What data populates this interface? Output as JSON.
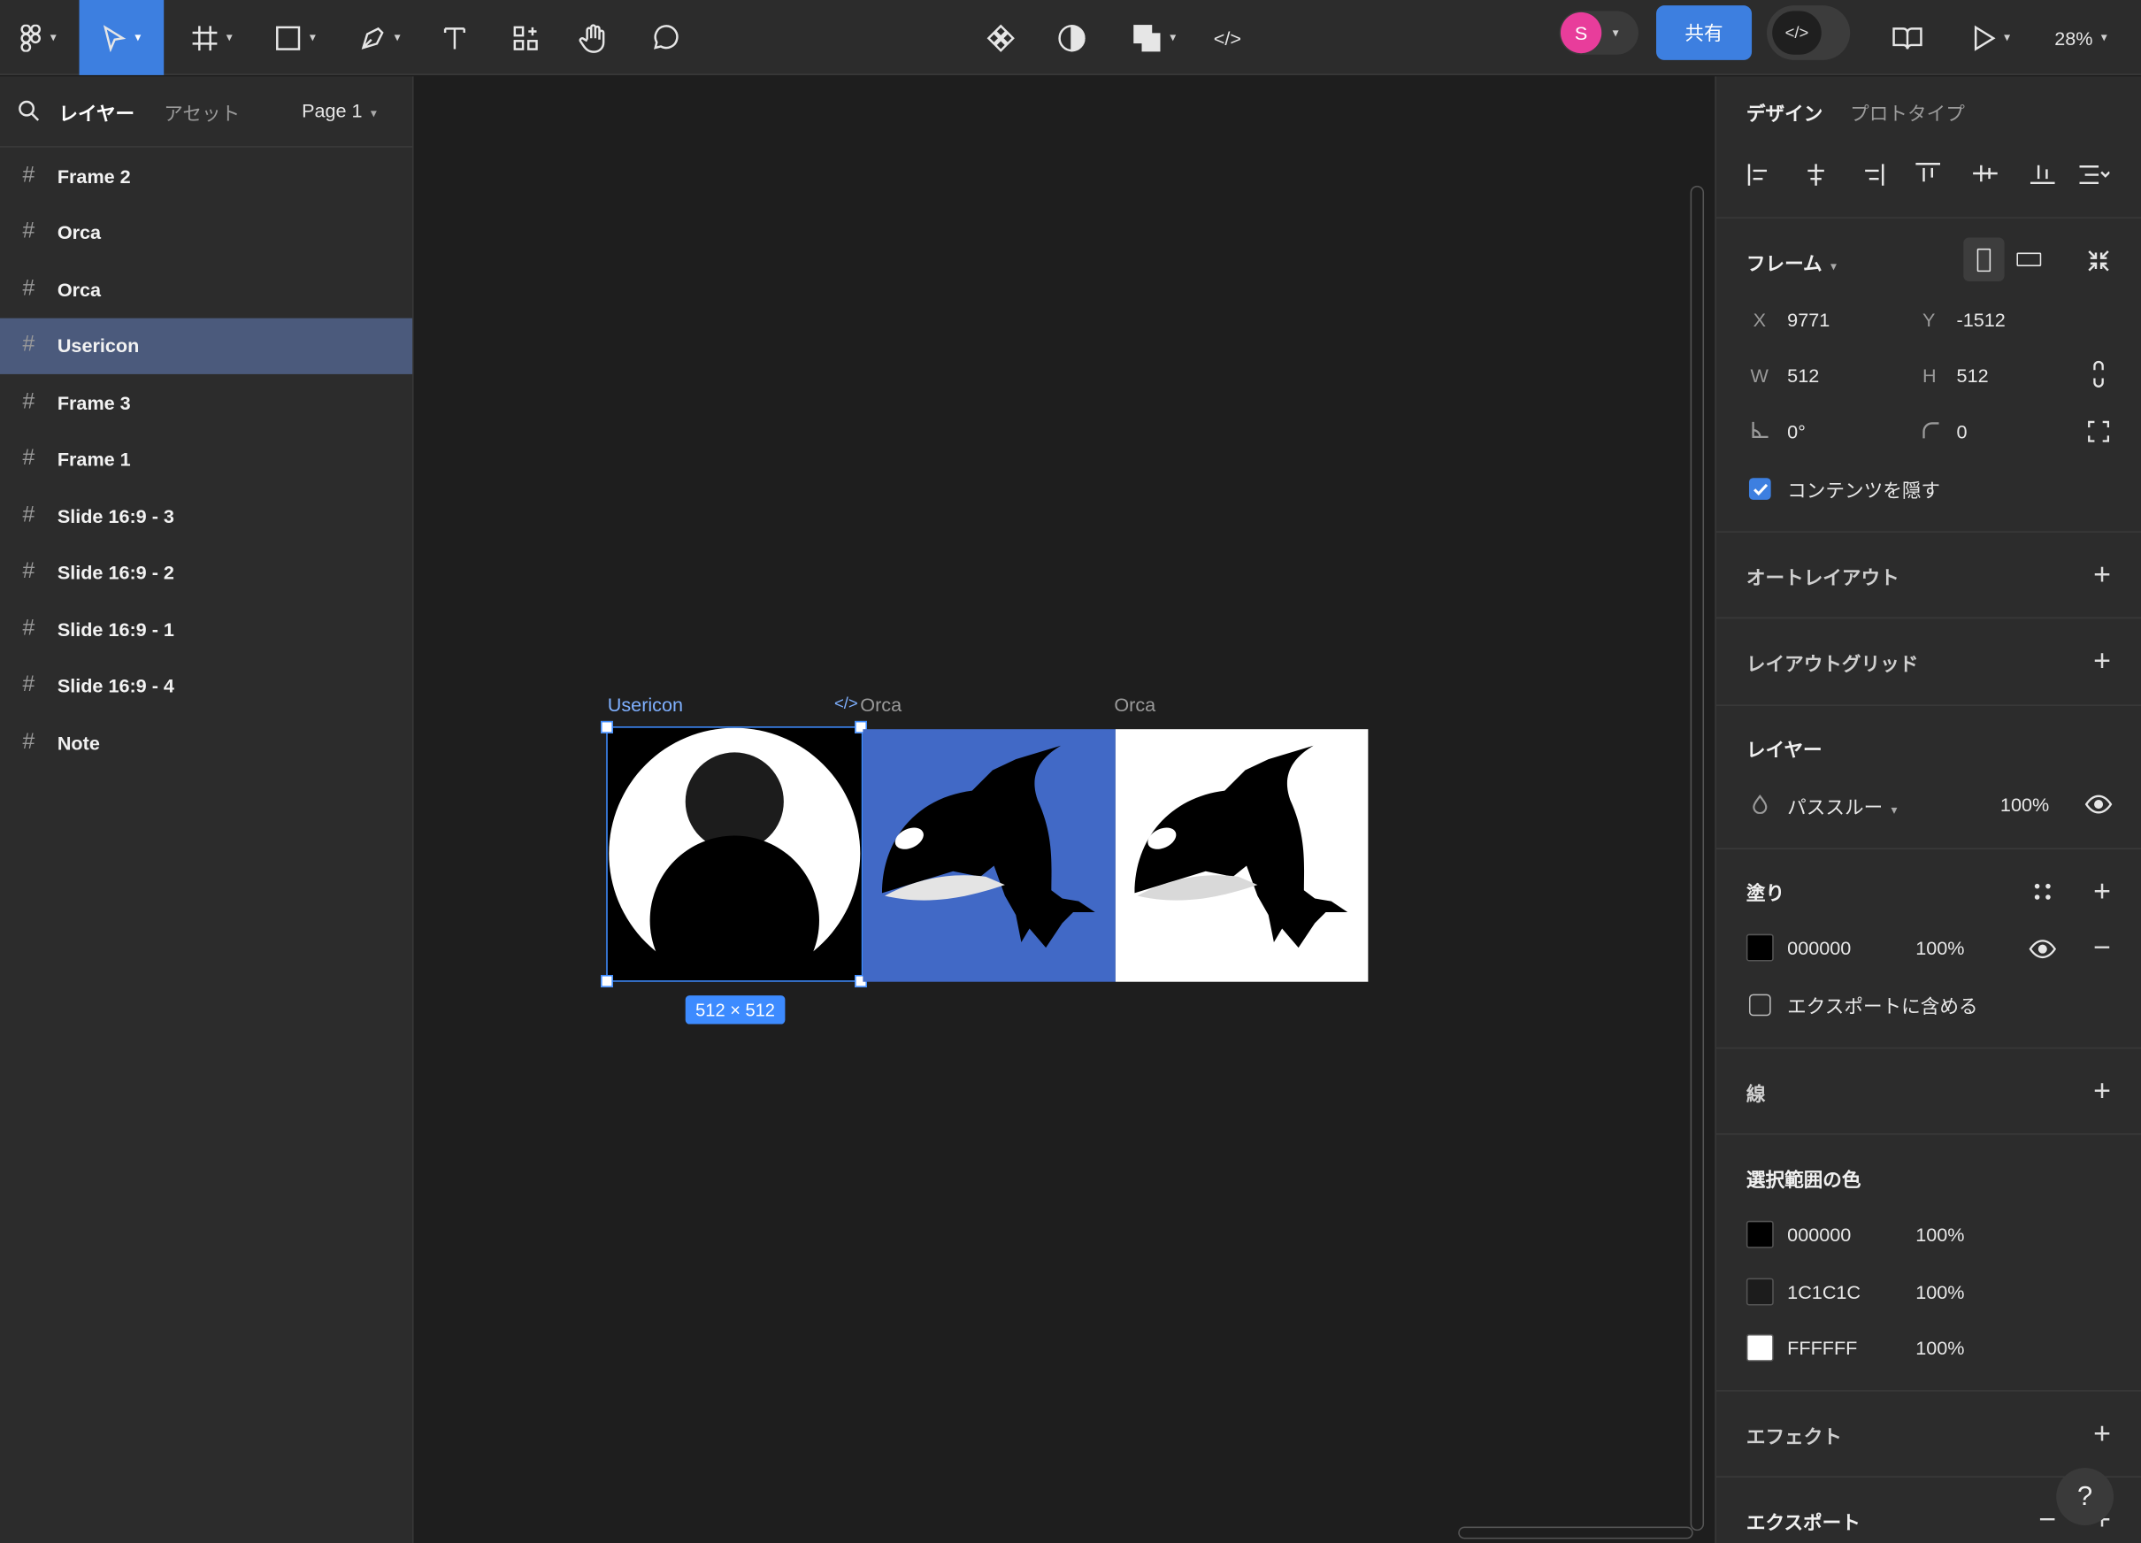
{
  "toolbar": {
    "zoom": "28%",
    "share_label": "共有",
    "avatar_initial": "S",
    "code_label": "</>"
  },
  "left_panel": {
    "tab_layers": "レイヤー",
    "tab_assets": "アセット",
    "page": "Page 1",
    "layers": [
      {
        "name": "Frame 2",
        "selected": false
      },
      {
        "name": "Orca",
        "selected": false
      },
      {
        "name": "Orca",
        "selected": false
      },
      {
        "name": "Usericon",
        "selected": true
      },
      {
        "name": "Frame 3",
        "selected": false
      },
      {
        "name": "Frame 1",
        "selected": false
      },
      {
        "name": "Slide 16:9 - 3",
        "selected": false
      },
      {
        "name": "Slide 16:9 - 2",
        "selected": false
      },
      {
        "name": "Slide 16:9 - 1",
        "selected": false
      },
      {
        "name": "Slide 16:9 - 4",
        "selected": false
      },
      {
        "name": "Note",
        "selected": false
      }
    ]
  },
  "canvas": {
    "frame_labels": [
      "Usericon",
      "Orca",
      "Orca"
    ],
    "code_icon_glyph": "</>",
    "size_badge": "512 × 512",
    "frame_colors": {
      "usericon_bg": "#000000",
      "orca1_bg": "#4169c6",
      "orca2_bg": "#ffffff"
    }
  },
  "right_panel": {
    "tab_design": "デザイン",
    "tab_prototype": "プロトタイプ",
    "frame_section": "フレーム",
    "x_label": "X",
    "x_value": "9771",
    "y_label": "Y",
    "y_value": "-1512",
    "w_label": "W",
    "w_value": "512",
    "h_label": "H",
    "h_value": "512",
    "rotation": "0°",
    "radius": "0",
    "clip_content": "コンテンツを隠す",
    "auto_layout": "オートレイアウト",
    "layout_grid": "レイアウトグリッド",
    "layer_section": "レイヤー",
    "blend_mode": "パススルー",
    "layer_opacity": "100%",
    "fill_section": "塗り",
    "fill_hex": "000000",
    "fill_opacity": "100%",
    "export_include": "エクスポートに含める",
    "stroke_section": "線",
    "selection_colors_section": "選択範囲の色",
    "selection_colors": [
      {
        "hex": "000000",
        "opacity": "100%",
        "color": "#000000"
      },
      {
        "hex": "1C1C1C",
        "opacity": "100%",
        "color": "#1c1c1c"
      },
      {
        "hex": "FFFFFF",
        "opacity": "100%",
        "color": "#ffffff"
      }
    ],
    "effects_section": "エフェクト",
    "export_section": "エクスポート",
    "help": "?"
  }
}
